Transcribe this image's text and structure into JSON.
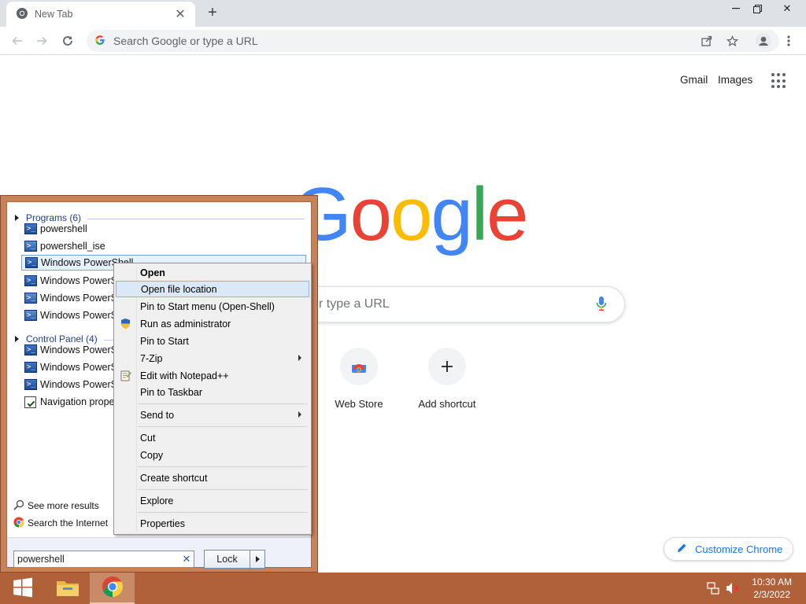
{
  "browser": {
    "tab_title": "New Tab",
    "omnibox_placeholder": "Search Google or type a URL"
  },
  "ntp": {
    "gmail": "Gmail",
    "images": "Images",
    "search_placeholder_visible": "r type a URL",
    "shortcuts": [
      {
        "label": "Web Store"
      },
      {
        "label": "Add shortcut"
      }
    ],
    "customize": "Customize Chrome"
  },
  "start_menu": {
    "programs_header": "Programs (6)",
    "control_panel_header": "Control Panel (4)",
    "programs": [
      {
        "label": "powershell"
      },
      {
        "label": "powershell_ise"
      },
      {
        "label": "Windows PowerShell"
      },
      {
        "label": "Windows PowerSh"
      },
      {
        "label": "Windows PowerSh"
      },
      {
        "label": "Windows PowerSh"
      }
    ],
    "control_panel": [
      {
        "label": "Windows PowerSh"
      },
      {
        "label": "Windows PowerSh"
      },
      {
        "label": "Windows PowerSh"
      },
      {
        "label": "Navigation proper"
      }
    ],
    "see_more": "See more results",
    "search_internet": "Search the Internet",
    "search_value": "powershell",
    "lock_label": "Lock"
  },
  "context_menu": {
    "items": [
      {
        "label": "Open"
      },
      {
        "label": "Open file location"
      },
      {
        "label": "Pin to Start menu (Open-Shell)"
      },
      {
        "label": "Run as administrator"
      },
      {
        "label": "Pin to Start"
      },
      {
        "label": "7-Zip"
      },
      {
        "label": "Edit with Notepad++"
      },
      {
        "label": "Pin to Taskbar"
      },
      {
        "label": "Send to"
      },
      {
        "label": "Cut"
      },
      {
        "label": "Copy"
      },
      {
        "label": "Create shortcut"
      },
      {
        "label": "Explore"
      },
      {
        "label": "Properties"
      }
    ]
  },
  "taskbar": {
    "time": "10:30 AM",
    "date": "2/3/2022"
  },
  "colors": {
    "accent": "#1a73e8",
    "taskbar": "#b0613a",
    "start_menu_frame": "#c8825a"
  }
}
